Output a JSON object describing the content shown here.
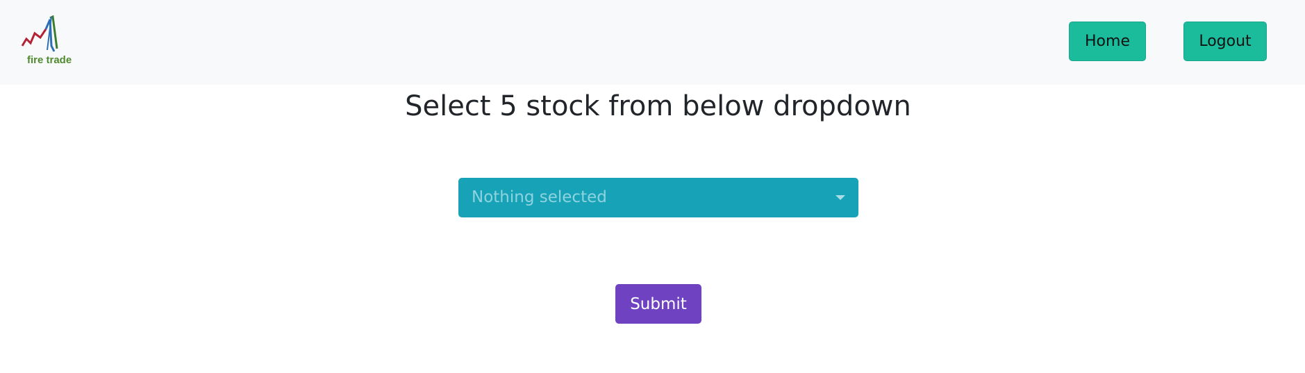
{
  "navbar": {
    "logo_text": "fire trade",
    "home_label": "Home",
    "logout_label": "Logout"
  },
  "main": {
    "title": "Select 5 stock from below dropdown",
    "dropdown_value": "Nothing selected",
    "submit_label": "Submit"
  },
  "colors": {
    "navbar_bg": "#f8f9fa",
    "nav_button": "#1abc9c",
    "dropdown_bg": "#17a2b8",
    "submit_bg": "#6f42c1"
  }
}
